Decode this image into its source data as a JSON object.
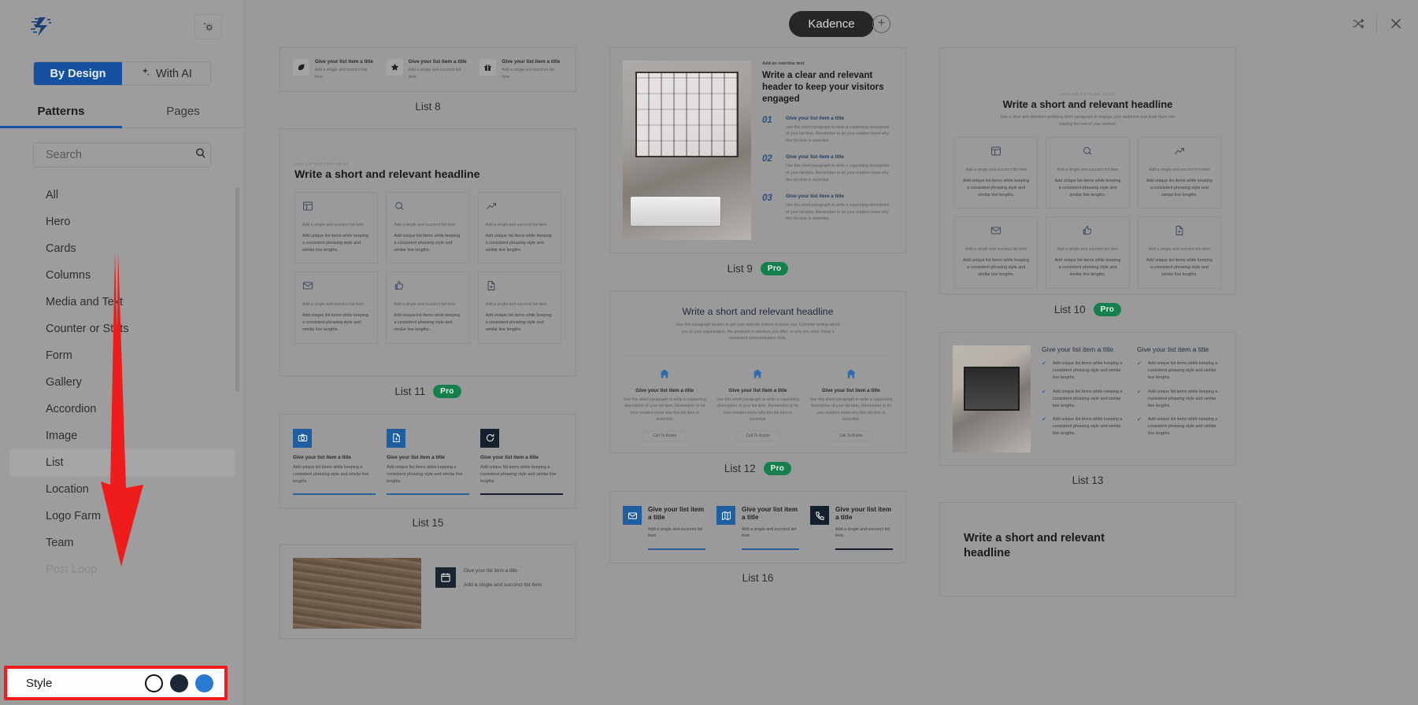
{
  "sidebar": {
    "logo_name": "kadence-logo",
    "settings_button_label": "",
    "segments": [
      {
        "label": "By Design",
        "active": true
      },
      {
        "label": "With AI",
        "active": false
      }
    ],
    "tabs": [
      {
        "label": "Patterns",
        "active": true
      },
      {
        "label": "Pages",
        "active": false
      }
    ],
    "search": {
      "value": "",
      "placeholder": "Search"
    },
    "categories": [
      {
        "label": "All",
        "state": "normal"
      },
      {
        "label": "Hero",
        "state": "normal"
      },
      {
        "label": "Cards",
        "state": "normal"
      },
      {
        "label": "Columns",
        "state": "normal"
      },
      {
        "label": "Media and Text",
        "state": "normal"
      },
      {
        "label": "Counter or Stats",
        "state": "normal"
      },
      {
        "label": "Form",
        "state": "normal"
      },
      {
        "label": "Gallery",
        "state": "normal"
      },
      {
        "label": "Accordion",
        "state": "normal"
      },
      {
        "label": "Image",
        "state": "normal"
      },
      {
        "label": "List",
        "state": "selected"
      },
      {
        "label": "Location",
        "state": "normal"
      },
      {
        "label": "Logo Farm",
        "state": "normal"
      },
      {
        "label": "Team",
        "state": "normal"
      },
      {
        "label": "Post Loop",
        "state": "faded"
      }
    ],
    "style_bar": {
      "label": "Style",
      "swatches": [
        {
          "name": "white",
          "color": "#ffffff",
          "selected": true
        },
        {
          "name": "dark",
          "color": "#1d2735",
          "selected": false
        },
        {
          "name": "blue",
          "color": "#2a7ad2",
          "selected": false
        }
      ],
      "highlight_color": "#f01b1b"
    },
    "annotation": {
      "arrow_color": "#f01b1b",
      "name": "red-down-arrow"
    }
  },
  "header": {
    "design_pill": "Kadence",
    "add_button": "+",
    "refresh_icon": "shuffle-icon",
    "close_icon": "close-icon"
  },
  "strings": {
    "eyebrow": "ADD AN OUTLINE TEXT",
    "headline_short": "Write a short and relevant headline",
    "headline_clear": "Write a clear and relevant header to keep your visitors engaged",
    "overline": "Add an overline text",
    "item_title": "Give your list item a title",
    "item_title_wrapped": "Give your list item a title",
    "succinct": "Add a single and succinct list item.",
    "succinct_plain": "Add a single and succinct list item",
    "unique": "Add unique list items while keeping a consistent phrasing style and similar line lengths.",
    "short_para": "Use this short paragraph to write a supporting description of your list item. Remember to let your readers know why this list item is essential.",
    "para_section": "Use this paragraph section to get your website visitors to know you. Consider writing about you or your organization, the products or services you offer, or why you exist. Keep a consistent communication style.",
    "sub_attention": "Use a clear and attention-grabbing short paragraph to engage your audience and draw them into reading the rest of your content.",
    "cta": "Call To Action",
    "numbers": [
      "01",
      "02",
      "03"
    ],
    "pro_badge": "Pro"
  },
  "patterns": {
    "list8": {
      "name": "List 8",
      "pro": false,
      "icons": [
        "leaf-icon",
        "star-icon",
        "gift-icon"
      ]
    },
    "list11": {
      "name": "List 11",
      "pro": true,
      "icons": [
        "layout-icon",
        "search-icon",
        "trending-up-icon",
        "mail-icon",
        "thumbs-up-icon",
        "file-plus-icon"
      ]
    },
    "list15": {
      "name": "List 15",
      "pro": false,
      "icons": [
        "camera-icon",
        "file-download-icon",
        "refresh-icon"
      ]
    },
    "list9": {
      "name": "List 9",
      "pro": true,
      "image": "desk-monitor-keyboard-photo"
    },
    "list12": {
      "name": "List 12",
      "pro": true,
      "icons": [
        "home-icon",
        "home-icon",
        "home-icon"
      ]
    },
    "list16": {
      "name": "List 16",
      "pro": false,
      "icons": [
        "mail-icon",
        "map-icon",
        "phone-icon"
      ]
    },
    "list10": {
      "name": "List 10",
      "pro": true,
      "icons": [
        "layout-icon",
        "search-icon",
        "trending-up-icon",
        "mail-icon",
        "thumbs-up-icon",
        "file-plus-icon"
      ]
    },
    "list13": {
      "name": "List 13",
      "pro": false,
      "image": "laptop-coffee-desk-photo"
    },
    "list17_partial": {
      "icons": [
        "calendar-icon"
      ],
      "image": "wood-texture-photo"
    },
    "list18_partial": {
      "headline": "Write a short and relevant headline"
    }
  }
}
